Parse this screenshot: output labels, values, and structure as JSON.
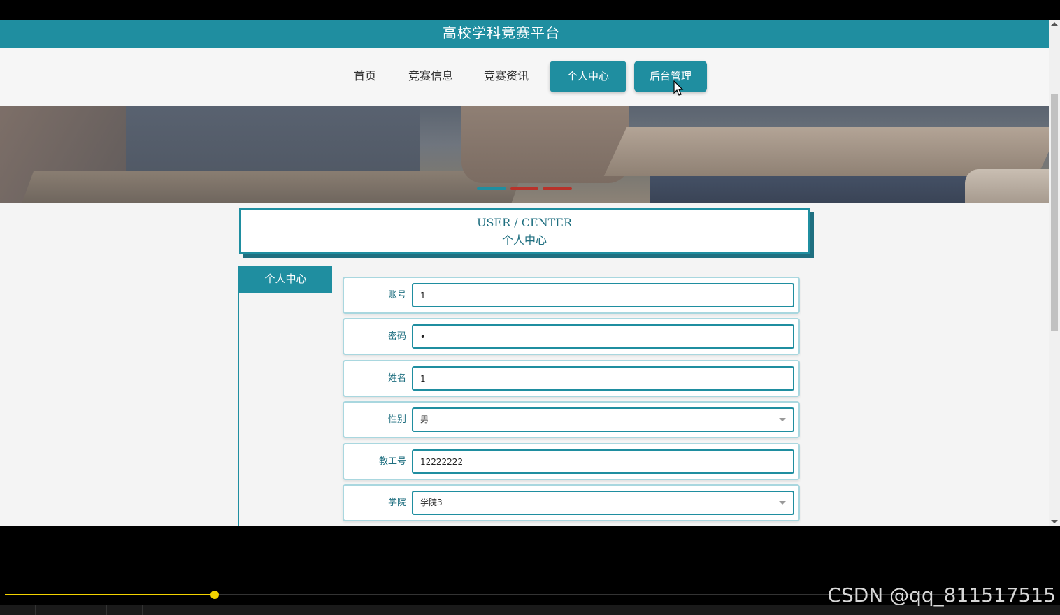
{
  "site": {
    "title": "高校学科竞赛平台"
  },
  "nav": {
    "links": [
      "首页",
      "竞赛信息",
      "竞赛资讯"
    ],
    "personal_center": "个人中心",
    "admin": "后台管理"
  },
  "user_center": {
    "title_en": "USER / CENTER",
    "title_cn": "个人中心"
  },
  "sidebar": {
    "tab": "个人中心"
  },
  "form": {
    "account": {
      "label": "账号",
      "value": "1"
    },
    "password": {
      "label": "密码",
      "value": "•"
    },
    "name": {
      "label": "姓名",
      "value": "1"
    },
    "gender": {
      "label": "性别",
      "value": "男"
    },
    "staff_id": {
      "label": "教工号",
      "value": "12222222"
    },
    "college": {
      "label": "学院",
      "value": "学院3"
    }
  },
  "player": {
    "progress": 0.2
  },
  "watermark": "CSDN @qq_811517515",
  "colors": {
    "accent": "#1f8ea0",
    "progress": "#f2d200"
  }
}
